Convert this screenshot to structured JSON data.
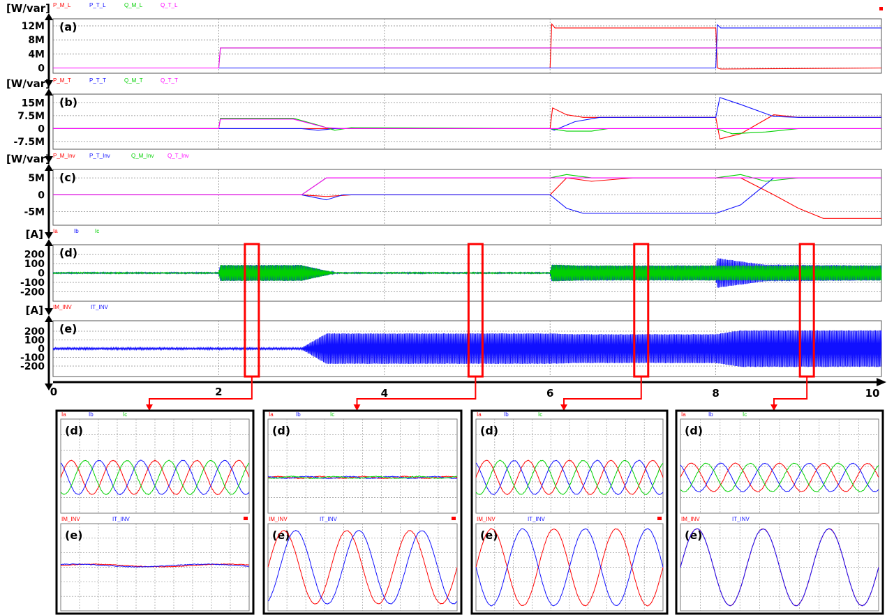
{
  "colors": {
    "red": "#ff0000",
    "blue": "#1010ff",
    "green": "#00d000",
    "magenta": "#ff00ff"
  },
  "chart_data": [
    {
      "type": "line",
      "panel": "(a)",
      "ylabel": "[W/var]",
      "yticks": [
        "12M",
        "8M",
        "4M",
        "0"
      ],
      "ylim": [
        -1.5,
        14
      ],
      "series": [
        {
          "name": "P_M_L",
          "color": "#ff0000",
          "x": [
            0,
            6,
            6.02,
            6.06,
            8.0,
            8.02,
            8.06,
            10
          ],
          "y": [
            0,
            0,
            12.5,
            11.4,
            11.4,
            0,
            -0.3,
            0
          ]
        },
        {
          "name": "P_T_L",
          "color": "#1010ff",
          "x": [
            0,
            8.0,
            8.02,
            8.06,
            10
          ],
          "y": [
            0,
            0,
            12.3,
            11.4,
            11.4
          ]
        },
        {
          "name": "Q_M_L",
          "color": "#00d000",
          "x": [
            0,
            2.0,
            2.02,
            10
          ],
          "y": [
            0,
            0,
            5.7,
            5.7
          ]
        },
        {
          "name": "Q_T_L",
          "color": "#ff00ff",
          "x": [
            0,
            2.0,
            2.02,
            10
          ],
          "y": [
            0,
            0,
            5.7,
            5.7
          ]
        }
      ]
    },
    {
      "type": "line",
      "panel": "(b)",
      "ylabel": "[W/var]",
      "yticks": [
        "15M",
        "7.5M",
        "0",
        "-7.5M"
      ],
      "ylim": [
        -12,
        20
      ],
      "series": [
        {
          "name": "P_M_T",
          "color": "#ff0000",
          "x": [
            0,
            2.0,
            3.0,
            3.2,
            3.4,
            4,
            6.0,
            6.03,
            6.2,
            6.4,
            7,
            8.0,
            8.05,
            8.3,
            8.7,
            9.0,
            10
          ],
          "y": [
            0,
            0,
            0,
            0,
            0,
            0,
            0,
            12,
            8,
            6.5,
            6.5,
            6.5,
            -6,
            -3,
            8,
            6.5,
            6.5
          ]
        },
        {
          "name": "P_T_T",
          "color": "#1010ff",
          "x": [
            0,
            2.0,
            3.0,
            3.2,
            3.4,
            4,
            6.0,
            6.05,
            6.3,
            6.6,
            8.0,
            8.05,
            8.3,
            8.7,
            9.0,
            10
          ],
          "y": [
            0,
            0,
            0,
            -1,
            0,
            0,
            0,
            -1,
            4,
            6.5,
            6.5,
            18,
            14,
            7,
            6.5,
            6.5
          ]
        },
        {
          "name": "Q_M_T",
          "color": "#00d000",
          "x": [
            0,
            2.0,
            2.02,
            2.9,
            3.2,
            3.4,
            3.6,
            6.0,
            6.2,
            6.5,
            6.7,
            8.0,
            8.2,
            8.6,
            9.0,
            9.2,
            10
          ],
          "y": [
            0,
            0,
            6,
            6,
            2,
            -1,
            0.5,
            0,
            -1.5,
            -1.5,
            0,
            0,
            -3,
            -2,
            0,
            0,
            0
          ]
        },
        {
          "name": "Q_T_T",
          "color": "#ff00ff",
          "x": [
            0,
            2.0,
            2.02,
            2.9,
            3.3,
            3.5,
            10
          ],
          "y": [
            0,
            0,
            5.5,
            5.5,
            0.5,
            0,
            0
          ]
        }
      ]
    },
    {
      "type": "line",
      "panel": "(c)",
      "ylabel": "[W/var]",
      "yticks": [
        "5M",
        "0",
        "-5M"
      ],
      "ylim": [
        -9,
        7.5
      ],
      "series": [
        {
          "name": "P_M_Inv",
          "color": "#ff0000",
          "x": [
            0,
            3.0,
            3.3,
            3.6,
            6.0,
            6.2,
            6.5,
            7,
            8.0,
            8.3,
            8.7,
            9.0,
            9.3,
            10
          ],
          "y": [
            0,
            0,
            -0.5,
            0,
            0,
            5,
            4,
            5,
            5,
            5,
            0,
            -4,
            -7,
            -7
          ]
        },
        {
          "name": "P_T_Inv",
          "color": "#1010ff",
          "x": [
            0,
            3.0,
            3.3,
            3.5,
            6.0,
            6.2,
            6.4,
            8.0,
            8.3,
            8.7,
            9.0,
            10
          ],
          "y": [
            0,
            0,
            -1.5,
            0,
            0,
            -4,
            -5.5,
            -5.5,
            -3,
            5,
            5,
            5
          ]
        },
        {
          "name": "Q_M_Inv",
          "color": "#00d000",
          "x": [
            0,
            3.0,
            3.3,
            3.5,
            6.0,
            6.2,
            6.5,
            8.0,
            8.3,
            8.6,
            9.0,
            10
          ],
          "y": [
            0,
            0,
            5,
            5,
            5,
            6,
            5,
            5,
            6,
            4,
            5,
            5
          ]
        },
        {
          "name": "Q_T_Inv",
          "color": "#ff00ff",
          "x": [
            0,
            3.0,
            3.3,
            10
          ],
          "y": [
            0,
            0,
            5,
            5
          ]
        }
      ]
    },
    {
      "type": "line",
      "panel": "(d)",
      "ylabel": "[A]",
      "yticks": [
        "200",
        "100",
        "0",
        "-100",
        "-200"
      ],
      "ylim": [
        -300,
        300
      ],
      "series": [
        {
          "name": "Ia",
          "color": "#ff0000",
          "envelope_x": [
            0,
            2.0,
            2.02,
            3.0,
            3.4,
            6.0,
            6.02,
            6.4,
            8.0,
            8.02,
            8.6,
            10
          ],
          "envelope_y": [
            5,
            5,
            95,
            95,
            5,
            5,
            110,
            90,
            90,
            85,
            90,
            90
          ]
        },
        {
          "name": "Ib",
          "color": "#1010ff",
          "envelope_x": [
            0,
            2.0,
            2.02,
            3.0,
            3.4,
            6.0,
            6.02,
            6.4,
            8.0,
            8.02,
            8.6,
            10
          ],
          "envelope_y": [
            5,
            5,
            95,
            95,
            5,
            5,
            100,
            90,
            90,
            180,
            100,
            90
          ]
        },
        {
          "name": "Ic",
          "color": "#00d000",
          "envelope_x": [
            0,
            2.0,
            2.02,
            3.0,
            3.4,
            6.0,
            6.02,
            6.4,
            8.0,
            8.02,
            8.6,
            10
          ],
          "envelope_y": [
            5,
            5,
            95,
            95,
            5,
            5,
            100,
            90,
            90,
            90,
            90,
            90
          ]
        }
      ]
    },
    {
      "type": "line",
      "panel": "(e)",
      "ylabel": "[A]",
      "yticks": [
        "200",
        "100",
        "0",
        "-100",
        "-200"
      ],
      "ylim": [
        -320,
        320
      ],
      "series": [
        {
          "name": "IM_INV",
          "color": "#ff0000",
          "envelope_x": [
            0,
            3.0,
            3.3,
            6.0,
            6.3,
            8.0,
            8.3,
            10
          ],
          "envelope_y": [
            10,
            10,
            200,
            200,
            240,
            240,
            200,
            200
          ]
        },
        {
          "name": "IT_INV",
          "color": "#1010ff",
          "envelope_x": [
            0,
            3.0,
            3.3,
            6.0,
            6.3,
            8.0,
            8.3,
            10
          ],
          "envelope_y": [
            10,
            10,
            200,
            200,
            190,
            190,
            240,
            240
          ]
        }
      ]
    }
  ],
  "time_axis": {
    "ticks": [
      "0",
      "2",
      "4",
      "6",
      "8",
      "10"
    ],
    "xlim": [
      0,
      10
    ]
  },
  "zooms": [
    {
      "x": 2.4,
      "d_labels": [
        "Ia",
        "Ib",
        "Ic"
      ],
      "e_labels": [
        "IM_INV",
        "IT_INV"
      ],
      "d_amp": [
        0.18,
        0.18,
        0.18
      ],
      "e_amp": [
        0.02,
        0.02
      ],
      "e_phase": [
        0,
        0.3
      ],
      "d_cycles": 4.5,
      "e_cycles": 3,
      "panel_d": "(d)",
      "panel_e": "(e)"
    },
    {
      "x": 5.1,
      "d_labels": [
        "Ia",
        "Ib",
        "Ic"
      ],
      "e_labels": [
        "IM_INV",
        "IT_INV"
      ],
      "d_amp": [
        0.01,
        0.01,
        0.01
      ],
      "e_amp": [
        0.42,
        0.42
      ],
      "e_phase": [
        0,
        -1.2
      ],
      "d_cycles": 4.5,
      "e_cycles": 3,
      "panel_d": "(d)",
      "panel_e": "(e)"
    },
    {
      "x": 7.1,
      "d_labels": [
        "Ia",
        "Ib",
        "Ic"
      ],
      "e_labels": [
        "IM_INV",
        "IT_INV"
      ],
      "d_amp": [
        0.18,
        0.18,
        0.18
      ],
      "e_amp": [
        0.44,
        0.44
      ],
      "e_phase": [
        0,
        3.14
      ],
      "d_cycles": 4.5,
      "e_cycles": 3,
      "panel_d": "(d)",
      "panel_e": "(e)"
    },
    {
      "x": 9.1,
      "d_labels": [
        "Ia",
        "Ib",
        "Ic"
      ],
      "e_labels": [
        "IM_INV",
        "IT_INV"
      ],
      "d_amp": [
        0.15,
        0.15,
        0.15
      ],
      "e_amp": [
        0.44,
        0.44
      ],
      "e_phase": [
        0,
        0
      ],
      "d_cycles": 4.5,
      "e_cycles": 3,
      "panel_d": "(d)",
      "panel_e": "(e)"
    }
  ]
}
